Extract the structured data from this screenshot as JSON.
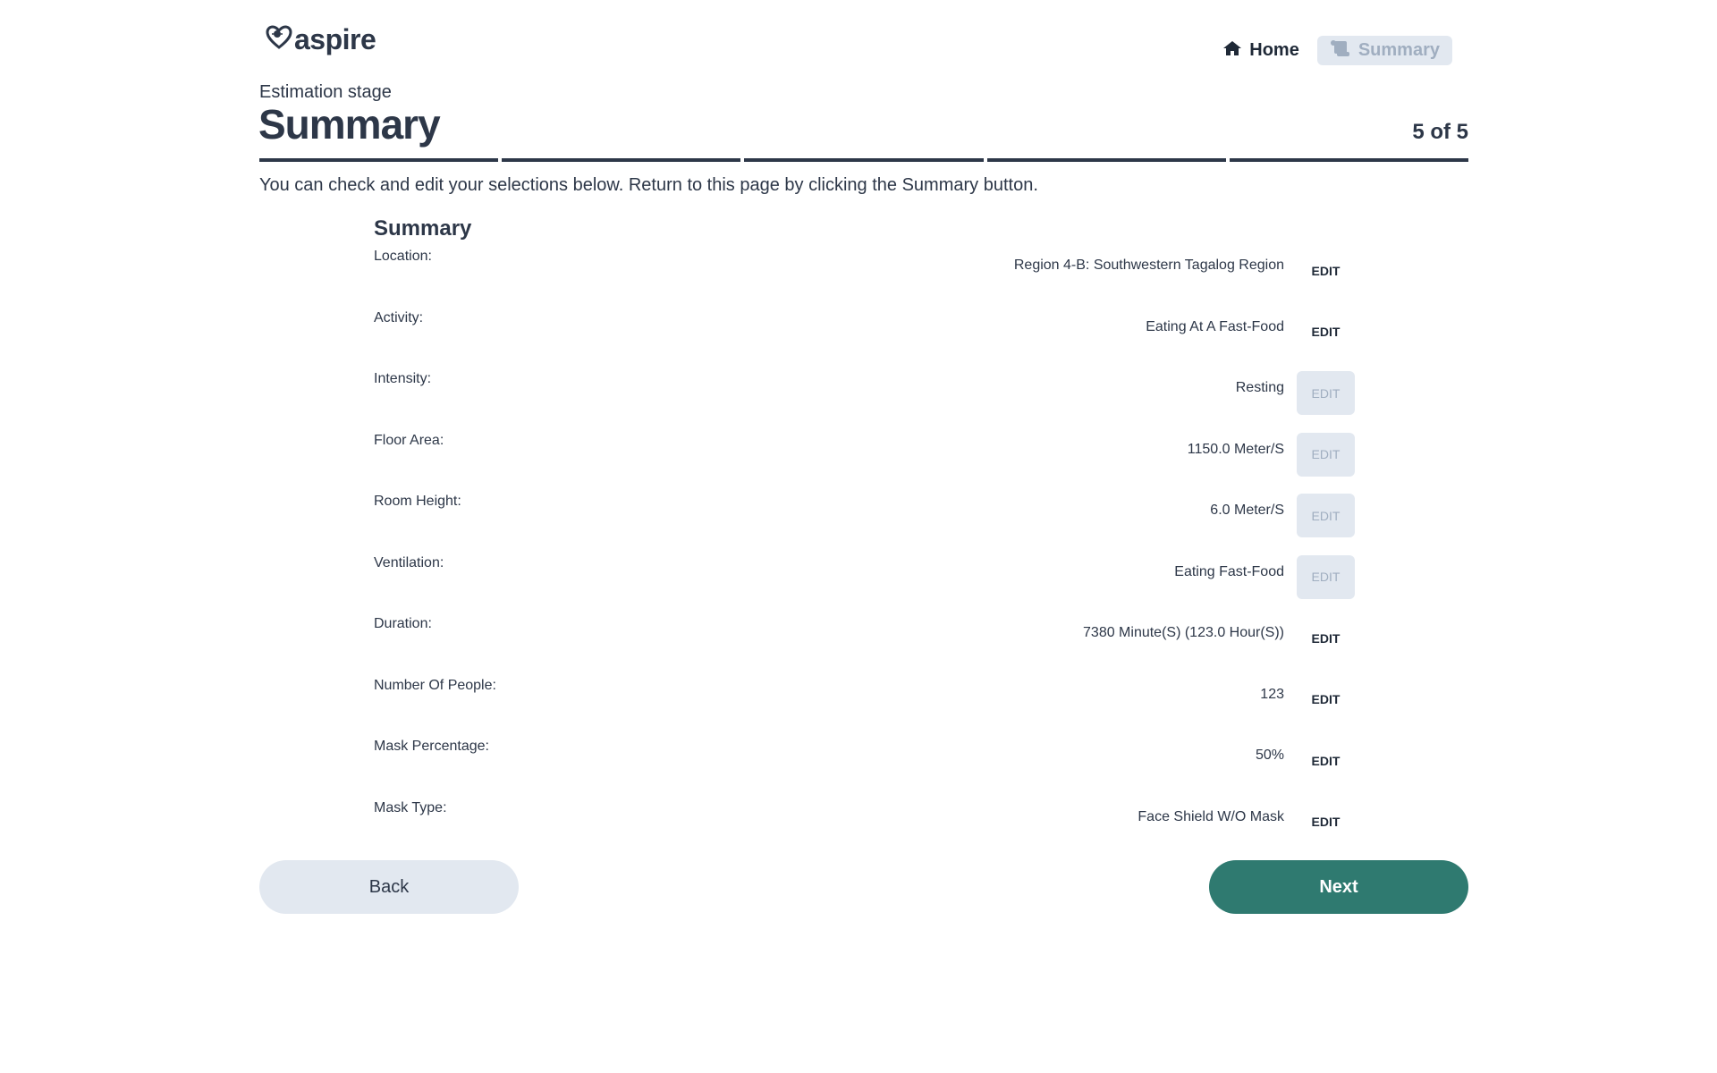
{
  "header": {
    "logo_text": "aspire",
    "nav": {
      "home_label": "Home",
      "summary_label": "Summary"
    }
  },
  "stage": {
    "label": "Estimation stage",
    "title": "Summary",
    "step": "5 of 5",
    "progress": {
      "current": 5,
      "total": 5
    }
  },
  "intro": "You can check and edit your selections below. Return to this page by clicking the Summary button.",
  "summary": {
    "title": "Summary",
    "rows": [
      {
        "label": "Location:",
        "value": "Region 4-B: Southwestern Tagalog Region",
        "edit": "EDIT",
        "edit_enabled": true
      },
      {
        "label": "Activity:",
        "value": "Eating At A Fast-Food",
        "edit": "EDIT",
        "edit_enabled": true
      },
      {
        "label": "Intensity:",
        "value": "Resting",
        "edit": "EDIT",
        "edit_enabled": false
      },
      {
        "label": "Floor Area:",
        "value": "1150.0 Meter/S",
        "edit": "EDIT",
        "edit_enabled": false
      },
      {
        "label": "Room Height:",
        "value": "6.0 Meter/S",
        "edit": "EDIT",
        "edit_enabled": false
      },
      {
        "label": "Ventilation:",
        "value": "Eating Fast-Food",
        "edit": "EDIT",
        "edit_enabled": false
      },
      {
        "label": "Duration:",
        "value": "7380 Minute(S) (123.0 Hour(S))",
        "edit": "EDIT",
        "edit_enabled": true
      },
      {
        "label": "Number Of People:",
        "value": "123",
        "edit": "EDIT",
        "edit_enabled": true
      },
      {
        "label": "Mask Percentage:",
        "value": "50%",
        "edit": "EDIT",
        "edit_enabled": true
      },
      {
        "label": "Mask Type:",
        "value": "Face Shield W/O Mask",
        "edit": "EDIT",
        "edit_enabled": true
      }
    ]
  },
  "footer": {
    "back_label": "Back",
    "next_label": "Next"
  },
  "colors": {
    "text": "#2d3748",
    "accent": "#2f7a70",
    "muted_bg": "#e2e8f0",
    "muted_text": "#a0aec0"
  },
  "icons": {
    "logo": "heart-virus-icon",
    "home": "house-icon",
    "summary": "scroll-icon"
  }
}
